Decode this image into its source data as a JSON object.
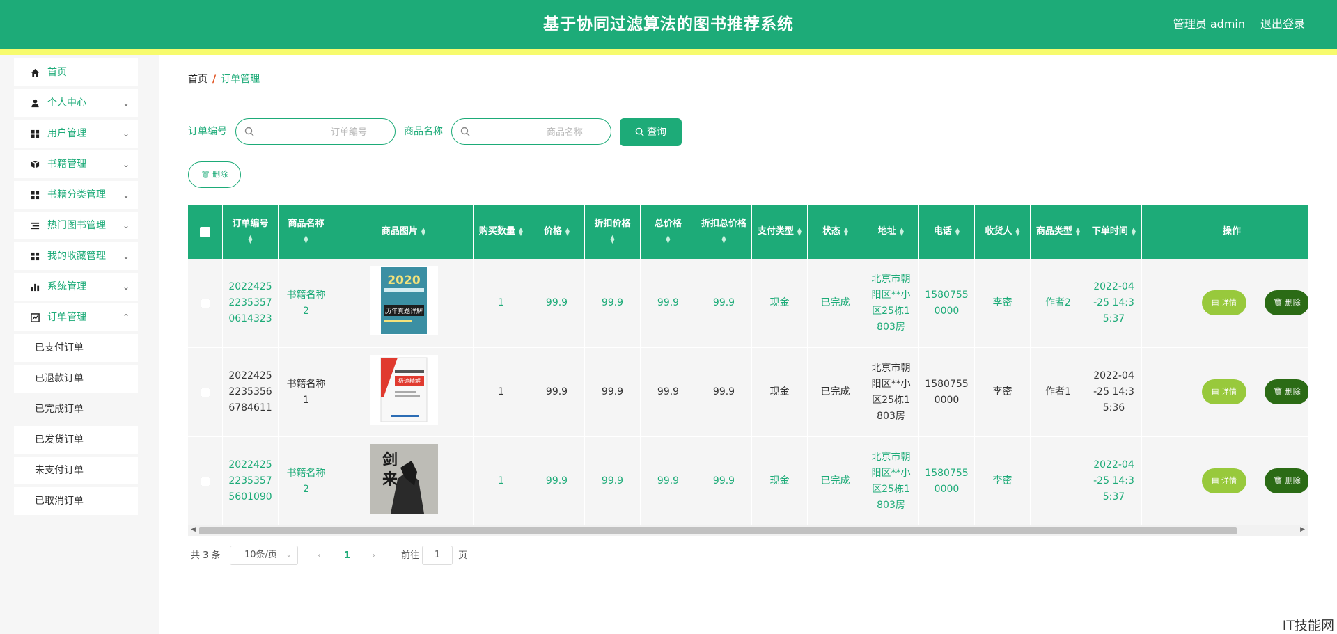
{
  "header": {
    "title": "基于协同过滤算法的图书推荐系统",
    "user": "管理员 admin",
    "logout": "退出登录",
    "colors": {
      "primary": "#1dab78",
      "stripe": "#f7fb6d"
    }
  },
  "sidebar": {
    "items": [
      {
        "label": "首页",
        "icon": "home-icon",
        "expandable": false
      },
      {
        "label": "个人中心",
        "icon": "person-icon",
        "expandable": true
      },
      {
        "label": "用户管理",
        "icon": "grid-icon",
        "expandable": true
      },
      {
        "label": "书籍管理",
        "icon": "books-icon",
        "expandable": true
      },
      {
        "label": "书籍分类管理",
        "icon": "grid-icon",
        "expandable": true
      },
      {
        "label": "热门图书管理",
        "icon": "list-icon",
        "expandable": true
      },
      {
        "label": "我的收藏管理",
        "icon": "grid-icon",
        "expandable": true
      },
      {
        "label": "系统管理",
        "icon": "bar-chart-icon",
        "expandable": true
      },
      {
        "label": "订单管理",
        "icon": "trend-chart-icon",
        "expandable": true
      }
    ],
    "sub_items": [
      "已支付订单",
      "已退款订单",
      "已完成订单",
      "已发货订单",
      "未支付订单",
      "已取消订单"
    ],
    "active_sub": "已完成订单"
  },
  "breadcrumb": {
    "home": "首页",
    "separator": "/",
    "current": "订单管理"
  },
  "search": {
    "order_label": "订单编号",
    "order_placeholder": "订单编号",
    "product_label": "商品名称",
    "product_placeholder": "商品名称",
    "query_label": "查询"
  },
  "toolbar": {
    "delete_label": "删除"
  },
  "table": {
    "columns": [
      "订单编号",
      "商品名称",
      "商品图片",
      "购买数量",
      "价格",
      "折扣价格",
      "总价格",
      "折扣总价格",
      "支付类型",
      "状态",
      "地址",
      "电话",
      "收货人",
      "商品类型",
      "下单时间",
      "操作"
    ],
    "rows": [
      {
        "order_no": "20224252235357 0614323",
        "order_lines": [
          "2022425",
          "2235357",
          "0614323"
        ],
        "name": "书籍名称2",
        "name_lines": [
          "书籍名称",
          "2"
        ],
        "cover": "book-cover-exam",
        "qty": "1",
        "price": "99.9",
        "discount_price": "99.9",
        "total": "99.9",
        "discount_total": "99.9",
        "pay_type": "现金",
        "status": "已完成",
        "address_lines": [
          "北京市朝",
          "阳区**小",
          "区25栋1",
          "803房"
        ],
        "phone_lines": [
          "1580755",
          "0000"
        ],
        "receiver": "李密",
        "category": "作者2",
        "time_lines": [
          "2022-04",
          "-25 14:3",
          "5:37"
        ],
        "tone": "green"
      },
      {
        "order_no": "20224252235356 6784611",
        "order_lines": [
          "2022425",
          "2235356",
          "6784611"
        ],
        "name": "书籍名称1",
        "name_lines": [
          "书籍名称",
          "1"
        ],
        "cover": "book-cover-english",
        "qty": "1",
        "price": "99.9",
        "discount_price": "99.9",
        "total": "99.9",
        "discount_total": "99.9",
        "pay_type": "现金",
        "status": "已完成",
        "address_lines": [
          "北京市朝",
          "阳区**小",
          "区25栋1",
          "803房"
        ],
        "phone_lines": [
          "1580755",
          "0000"
        ],
        "receiver": "李密",
        "category": "作者1",
        "time_lines": [
          "2022-04",
          "-25 14:3",
          "5:36"
        ],
        "tone": "dark"
      },
      {
        "order_no": "20224252235357 5601090",
        "order_lines": [
          "2022425",
          "2235357",
          "5601090"
        ],
        "name": "书籍名称2",
        "name_lines": [
          "书籍名称",
          "2"
        ],
        "cover": "book-cover-jianlai",
        "qty": "1",
        "price": "99.9",
        "discount_price": "99.9",
        "total": "99.9",
        "discount_total": "99.9",
        "pay_type": "现金",
        "status": "已完成",
        "address_lines": [
          "北京市朝",
          "阳区**小",
          "区25栋1",
          "803房"
        ],
        "phone_lines": [
          "1580755",
          "0000"
        ],
        "receiver": "李密",
        "category": "",
        "time_lines": [
          "2022-04",
          "-25 14:3",
          "5:37"
        ],
        "tone": "green"
      }
    ],
    "detail_label": "详情",
    "delete_label": "删除"
  },
  "pagination": {
    "total": "共 3 条",
    "page_size": "10条/页",
    "current_page": "1",
    "goto_label": "前往",
    "goto_value": "1",
    "page_unit": "页"
  },
  "watermark": "IT技能网"
}
